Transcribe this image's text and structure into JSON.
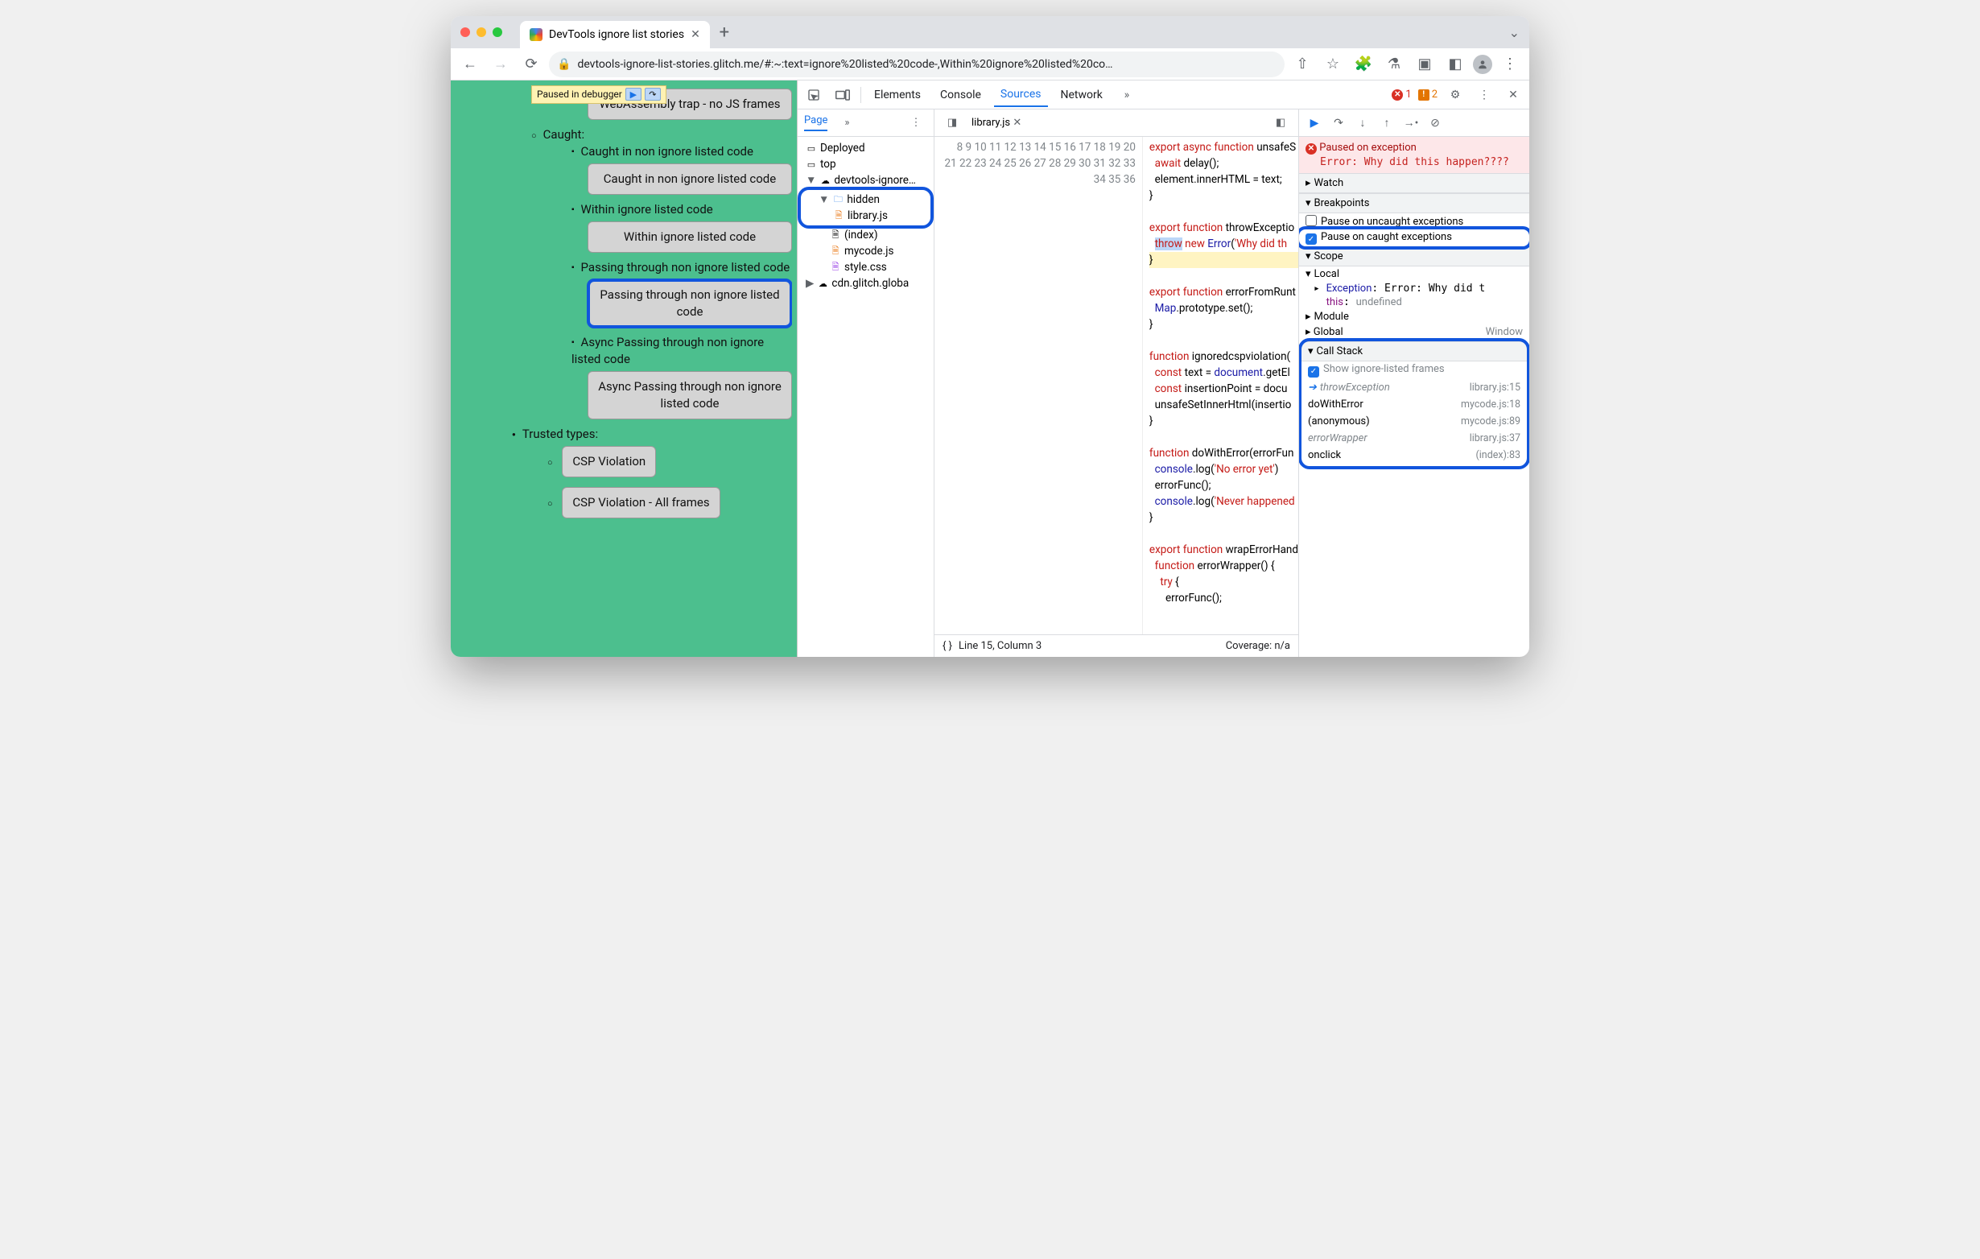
{
  "browser": {
    "tab_title": "DevTools ignore list stories",
    "url_display": "devtools-ignore-list-stories.glitch.me/#:~:text=ignore%20listed%20code-,Within%20ignore%20listed%20co…",
    "paused_label": "Paused in debugger"
  },
  "page": {
    "top_button": "WebAssembly trap - no JS frames",
    "caught_heading": "Caught:",
    "items": [
      {
        "label": "Caught in non ignore listed code",
        "button": "Caught in non ignore listed code"
      },
      {
        "label": "Within ignore listed code",
        "button": "Within ignore listed code"
      },
      {
        "label": "Passing through non ignore listed code",
        "button": "Passing through non ignore listed code"
      },
      {
        "label": "Async Passing through non ignore listed code",
        "button": "Async Passing through non ignore listed code"
      }
    ],
    "trusted_heading": "Trusted types:",
    "trusted_buttons": [
      "CSP Violation",
      "CSP Violation - All frames"
    ]
  },
  "devtools": {
    "panels": [
      "Elements",
      "Console",
      "Sources",
      "Network"
    ],
    "active_panel": "Sources",
    "errors": "1",
    "warnings": "2",
    "left": {
      "tab": "Page",
      "tree": {
        "deployed": "Deployed",
        "top": "top",
        "origin": "devtools-ignore…",
        "hidden": "hidden",
        "library": "library.js",
        "index": "(index)",
        "mycode": "mycode.js",
        "style": "style.css",
        "cdn": "cdn.glitch.globa"
      }
    },
    "editor": {
      "filename": "library.js",
      "first_line": 8,
      "lines": [
        "export async function unsafeS",
        "  await delay();",
        "  element.innerHTML = text;",
        "}",
        "",
        "export function throwExceptio",
        "  throw new Error('Why did th",
        "}",
        "",
        "export function errorFromRunt",
        "  Map.prototype.set();",
        "}",
        "",
        "function ignoredcspviolation(",
        "  const text = document.getEl",
        "  const insertionPoint = docu",
        "  unsafeSetInnerHtml(insertio",
        "}",
        "",
        "function doWithError(errorFun",
        "  console.log('No error yet')",
        "  errorFunc();",
        "  console.log('Never happened",
        "}",
        "",
        "export function wrapErrorHand",
        "  function errorWrapper() {",
        "    try {",
        "      errorFunc();"
      ],
      "highlight_line": 15,
      "status_left": "Line 15, Column 3",
      "status_right": "Coverage: n/a"
    },
    "right": {
      "paused_title": "Paused on exception",
      "paused_msg": "Error: Why did this happen????",
      "watch": "Watch",
      "breakpoints": "Breakpoints",
      "bp_uncaught": "Pause on uncaught exceptions",
      "bp_caught": "Pause on caught exceptions",
      "scope": "Scope",
      "scope_local": "Local",
      "scope_exception": "Exception: Error: Why did t",
      "scope_this": "this: undefined",
      "scope_module": "Module",
      "scope_global": "Global",
      "scope_global_val": "Window",
      "call_stack": "Call Stack",
      "show_ignore": "Show ignore-listed frames",
      "frames": [
        {
          "name": "throwException",
          "loc": "library.js:15",
          "ignored": true,
          "current": true
        },
        {
          "name": "doWithError",
          "loc": "mycode.js:18"
        },
        {
          "name": "(anonymous)",
          "loc": "mycode.js:89"
        },
        {
          "name": "errorWrapper",
          "loc": "library.js:37",
          "ignored": true
        },
        {
          "name": "onclick",
          "loc": "(index):83"
        }
      ]
    }
  }
}
